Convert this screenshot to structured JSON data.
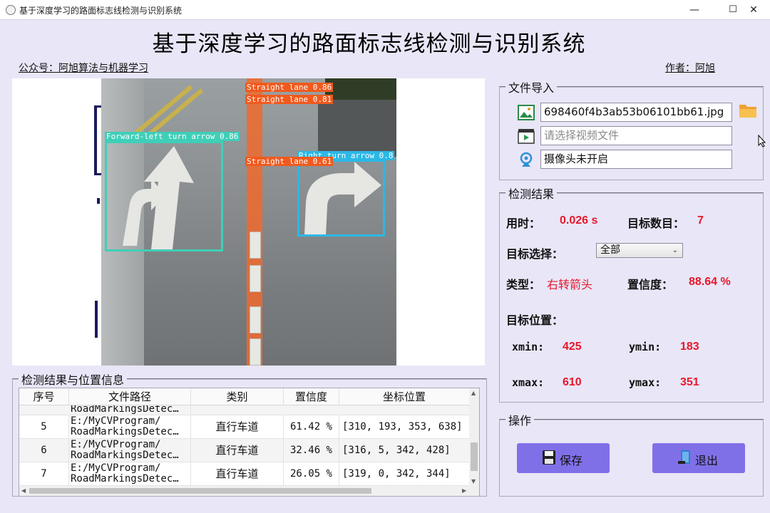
{
  "window": {
    "title": "基于深度学习的路面标志线检测与识别系统",
    "minimize": "—",
    "maximize": "☐",
    "close": "✕"
  },
  "header": {
    "title": "基于深度学习的路面标志线检测与识别系统",
    "public_account": "公众号：阿旭算法与机器学习",
    "author": "作者：阿旭"
  },
  "image_view": {
    "detections": [
      {
        "label": "Straight lane 0.86",
        "color": "#f05a1e"
      },
      {
        "label": "Straight lane 0.81",
        "color": "#f05a1e"
      },
      {
        "label": "Forward-left turn arrow 0.86",
        "color": "#3fcfb8"
      },
      {
        "label": "Straight lane 0.61",
        "color": "#f05a1e"
      },
      {
        "label": "Right turn arrow 0.8",
        "color": "#2bb8e6"
      }
    ]
  },
  "file_import": {
    "legend": "文件导入",
    "image_file": "698460f4b3ab53b06101bb61.jpg",
    "video_placeholder": "请选择视频文件",
    "camera_status": "摄像头未开启"
  },
  "result": {
    "legend": "检测结果",
    "time_label": "用时：",
    "time_value": "0.026 s",
    "count_label": "目标数目：",
    "count_value": "7",
    "select_label": "目标选择：",
    "select_value": "全部",
    "type_label": "类型：",
    "type_value": "右转箭头",
    "conf_label": "置信度：",
    "conf_value": "88.64 %",
    "position_label": "目标位置：",
    "xmin_label": "xmin:",
    "xmin_value": "425",
    "ymin_label": "ymin:",
    "ymin_value": "183",
    "xmax_label": "xmax:",
    "xmax_value": "610",
    "ymax_label": "ymax:",
    "ymax_value": "351"
  },
  "operations": {
    "legend": "操作",
    "save_label": "保存",
    "exit_label": "退出"
  },
  "table": {
    "legend": "检测结果与位置信息",
    "columns": [
      "序号",
      "文件路径",
      "类别",
      "置信度",
      "坐标位置"
    ],
    "partial_row": {
      "path": "RoadMarkingsDetec…"
    },
    "rows": [
      {
        "index": "5",
        "path1": "E:/MyCVProgram/",
        "path2": "RoadMarkingsDetec…",
        "category": "直行车道",
        "confidence": "61.42 %",
        "coords": "[310, 193, 353, 638]"
      },
      {
        "index": "6",
        "path1": "E:/MyCVProgram/",
        "path2": "RoadMarkingsDetec…",
        "category": "直行车道",
        "confidence": "32.46 %",
        "coords": "[316, 5, 342, 428]"
      },
      {
        "index": "7",
        "path1": "E:/MyCVProgram/",
        "path2": "RoadMarkingsDetec…",
        "category": "直行车道",
        "confidence": "26.05 %",
        "coords": "[319, 0, 342, 344]"
      }
    ]
  },
  "colors": {
    "background": "#e9e6f7",
    "accent_button": "#8070e8",
    "value_red": "#e8172b"
  }
}
